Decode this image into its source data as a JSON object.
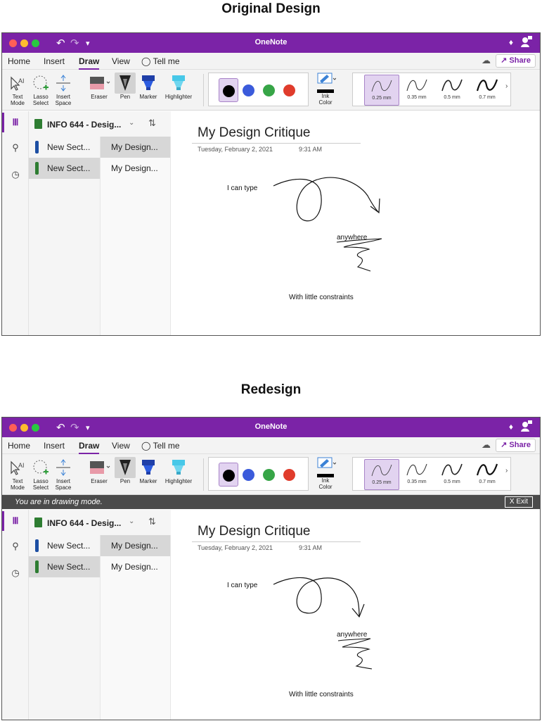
{
  "headings": {
    "original": "Original Design",
    "redesign": "Redesign"
  },
  "app": {
    "title": "OneNote"
  },
  "menu": {
    "home": "Home",
    "insert": "Insert",
    "draw": "Draw",
    "view": "View",
    "tell_me": "Tell me",
    "share": "Share"
  },
  "tools": {
    "text_mode": [
      "Text",
      "Mode"
    ],
    "lasso": [
      "Lasso",
      "Select"
    ],
    "insert_space": [
      "Insert",
      "Space"
    ],
    "eraser": "Eraser",
    "pen": "Pen",
    "marker": "Marker",
    "highlighter": "Highlighter",
    "ink_color": [
      "Ink",
      "Color"
    ]
  },
  "colors": [
    "#000000",
    "#3b5bdb",
    "#37a547",
    "#e03c2c"
  ],
  "thickness": [
    "0.25 mm",
    "0.35 mm",
    "0.5 mm",
    "0.7 mm"
  ],
  "drawing_bar": {
    "message": "You are in drawing mode.",
    "exit": "X  Exit"
  },
  "notebook": {
    "name": "INFO 644 - Desig..."
  },
  "sections": [
    "New Sect...",
    "New Sect..."
  ],
  "pages": [
    "My Design...",
    "My Design..."
  ],
  "page": {
    "title": "My Design Critique",
    "date": "Tuesday, February 2, 2021",
    "time": "9:31 AM",
    "notes": {
      "type": "I can type",
      "anywhere": "anywhere",
      "constraints": "With little constraints"
    }
  },
  "accent": "#7b23a7"
}
